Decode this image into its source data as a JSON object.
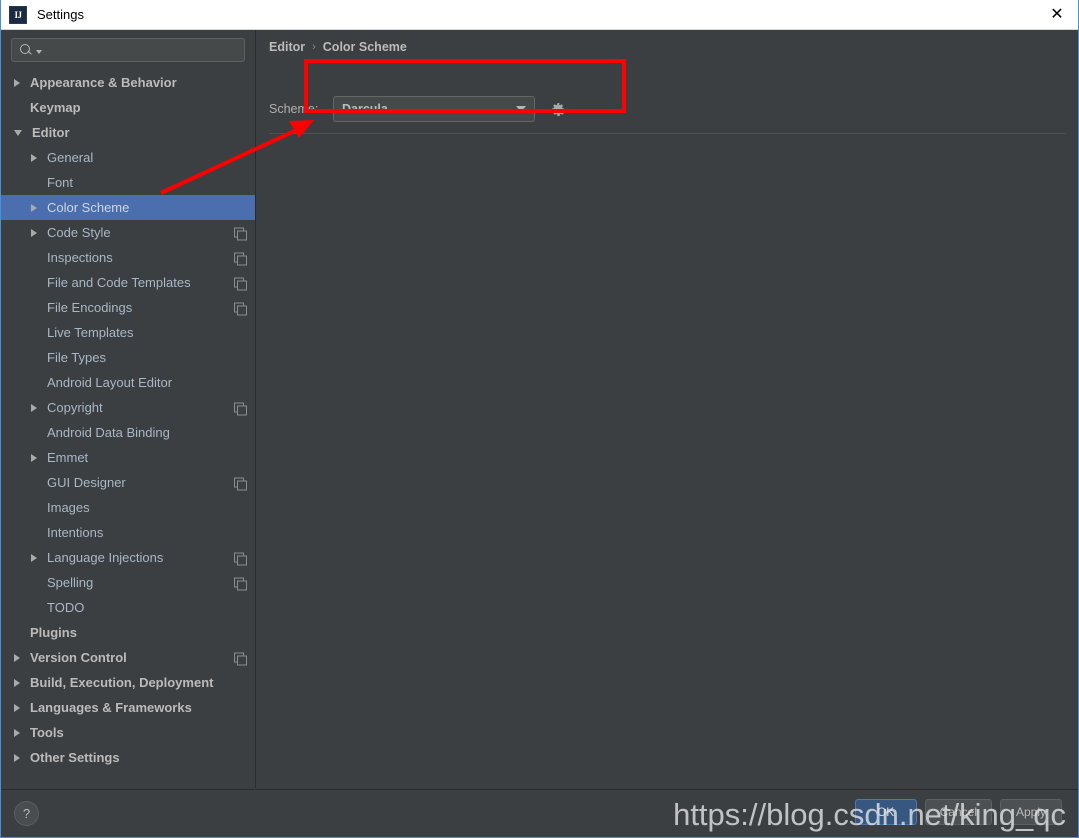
{
  "window": {
    "title": "Settings",
    "logo_text": "IJ",
    "close_label": "✕"
  },
  "sidebar": {
    "search": {
      "value": "",
      "placeholder": ""
    },
    "items": [
      {
        "label": "Appearance & Behavior",
        "indent": 0,
        "arrow": "collapsed",
        "bold": true,
        "copy": false,
        "selected": false
      },
      {
        "label": "Keymap",
        "indent": 0,
        "arrow": "none",
        "bold": true,
        "copy": false,
        "selected": false
      },
      {
        "label": "Editor",
        "indent": 0,
        "arrow": "expanded",
        "bold": true,
        "copy": false,
        "selected": false
      },
      {
        "label": "General",
        "indent": 1,
        "arrow": "collapsed",
        "bold": false,
        "copy": false,
        "selected": false
      },
      {
        "label": "Font",
        "indent": 1,
        "arrow": "none",
        "bold": false,
        "copy": false,
        "selected": false
      },
      {
        "label": "Color Scheme",
        "indent": 1,
        "arrow": "collapsed",
        "bold": false,
        "copy": false,
        "selected": true
      },
      {
        "label": "Code Style",
        "indent": 1,
        "arrow": "collapsed",
        "bold": false,
        "copy": true,
        "selected": false
      },
      {
        "label": "Inspections",
        "indent": 1,
        "arrow": "none",
        "bold": false,
        "copy": true,
        "selected": false
      },
      {
        "label": "File and Code Templates",
        "indent": 1,
        "arrow": "none",
        "bold": false,
        "copy": true,
        "selected": false
      },
      {
        "label": "File Encodings",
        "indent": 1,
        "arrow": "none",
        "bold": false,
        "copy": true,
        "selected": false
      },
      {
        "label": "Live Templates",
        "indent": 1,
        "arrow": "none",
        "bold": false,
        "copy": false,
        "selected": false
      },
      {
        "label": "File Types",
        "indent": 1,
        "arrow": "none",
        "bold": false,
        "copy": false,
        "selected": false
      },
      {
        "label": "Android Layout Editor",
        "indent": 1,
        "arrow": "none",
        "bold": false,
        "copy": false,
        "selected": false
      },
      {
        "label": "Copyright",
        "indent": 1,
        "arrow": "collapsed",
        "bold": false,
        "copy": true,
        "selected": false
      },
      {
        "label": "Android Data Binding",
        "indent": 1,
        "arrow": "none",
        "bold": false,
        "copy": false,
        "selected": false
      },
      {
        "label": "Emmet",
        "indent": 1,
        "arrow": "collapsed",
        "bold": false,
        "copy": false,
        "selected": false
      },
      {
        "label": "GUI Designer",
        "indent": 1,
        "arrow": "none",
        "bold": false,
        "copy": true,
        "selected": false
      },
      {
        "label": "Images",
        "indent": 1,
        "arrow": "none",
        "bold": false,
        "copy": false,
        "selected": false
      },
      {
        "label": "Intentions",
        "indent": 1,
        "arrow": "none",
        "bold": false,
        "copy": false,
        "selected": false
      },
      {
        "label": "Language Injections",
        "indent": 1,
        "arrow": "collapsed",
        "bold": false,
        "copy": true,
        "selected": false
      },
      {
        "label": "Spelling",
        "indent": 1,
        "arrow": "none",
        "bold": false,
        "copy": true,
        "selected": false
      },
      {
        "label": "TODO",
        "indent": 1,
        "arrow": "none",
        "bold": false,
        "copy": false,
        "selected": false
      },
      {
        "label": "Plugins",
        "indent": 0,
        "arrow": "none",
        "bold": true,
        "copy": false,
        "selected": false
      },
      {
        "label": "Version Control",
        "indent": 0,
        "arrow": "collapsed",
        "bold": true,
        "copy": true,
        "selected": false
      },
      {
        "label": "Build, Execution, Deployment",
        "indent": 0,
        "arrow": "collapsed",
        "bold": true,
        "copy": false,
        "selected": false
      },
      {
        "label": "Languages & Frameworks",
        "indent": 0,
        "arrow": "collapsed",
        "bold": true,
        "copy": false,
        "selected": false
      },
      {
        "label": "Tools",
        "indent": 0,
        "arrow": "collapsed",
        "bold": true,
        "copy": false,
        "selected": false
      },
      {
        "label": "Other Settings",
        "indent": 0,
        "arrow": "collapsed",
        "bold": true,
        "copy": false,
        "selected": false
      }
    ]
  },
  "main": {
    "breadcrumb": {
      "parent": "Editor",
      "separator": "›",
      "current": "Color Scheme"
    },
    "scheme": {
      "label": "Scheme:",
      "selected": "Darcula",
      "options": [
        "Darcula"
      ],
      "gear_icon": "gear-icon"
    }
  },
  "bottom": {
    "help_label": "?",
    "ok_label": "OK",
    "cancel_label": "Cancel",
    "apply_label": "Apply"
  },
  "watermark": {
    "text": "https://blog.csdn.net/king_qc"
  },
  "colors": {
    "window_bg": "#3c3f41",
    "titlebar_bg": "#ffffff",
    "selection_blue": "#4b6eaf",
    "primary_button": "#365880",
    "annotation_red": "#fe0000",
    "text": "#a9b7c6",
    "border_accent": "#4a90d9"
  }
}
